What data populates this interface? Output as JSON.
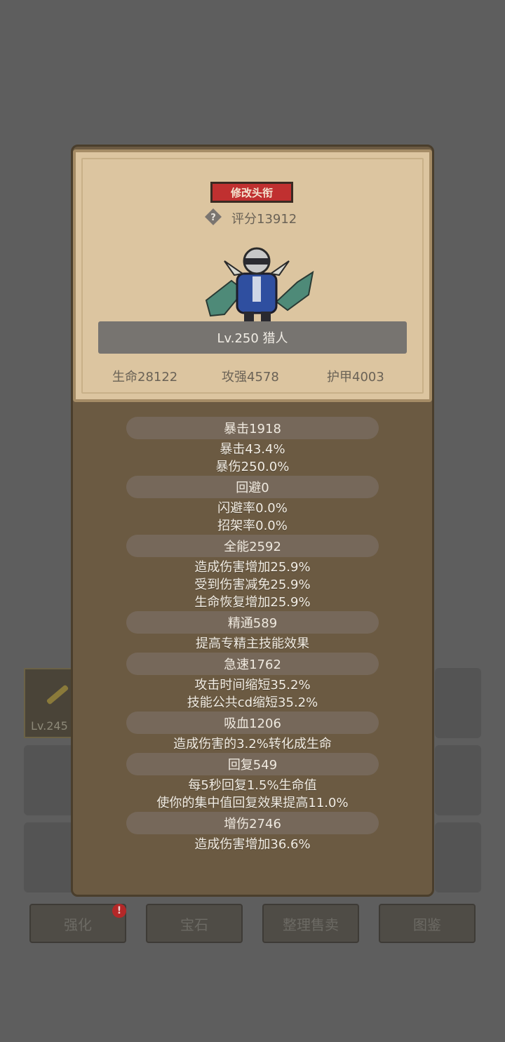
{
  "profile": {
    "edit_title_label": "修改头衔",
    "score_label": "评分13912",
    "level_class": "Lv.250 猎人",
    "hp": "生命28122",
    "attack": "攻强4578",
    "armor": "护甲4003"
  },
  "stats": [
    {
      "name": "暴击1918",
      "details": [
        "暴击43.4%",
        "暴伤250.0%"
      ]
    },
    {
      "name": "回避0",
      "details": [
        "闪避率0.0%",
        "招架率0.0%"
      ]
    },
    {
      "name": "全能2592",
      "details": [
        "造成伤害增加25.9%",
        "受到伤害减免25.9%",
        "生命恢复增加25.9%"
      ]
    },
    {
      "name": "精通589",
      "details": [
        "提高专精主技能效果"
      ]
    },
    {
      "name": "急速1762",
      "details": [
        "攻击时间缩短35.2%",
        "技能公共cd缩短35.2%"
      ]
    },
    {
      "name": "吸血1206",
      "details": [
        "造成伤害的3.2%转化成生命"
      ]
    },
    {
      "name": "回复549",
      "details": [
        "每5秒回复1.5%生命值",
        "使你的集中值回复效果提高11.0%"
      ]
    },
    {
      "name": "增伤2746",
      "details": [
        "造成伤害增加36.6%"
      ]
    }
  ],
  "background": {
    "item_level": "Lv.245",
    "buttons": [
      "强化",
      "宝石",
      "整理售卖",
      "图鉴"
    ],
    "badge": "!"
  },
  "colors": {
    "accent_red": "#c03030",
    "panel": "#6b5a42",
    "card": "#dcc5a0"
  },
  "icons": {
    "help": "question-diamond-icon",
    "hero": "hunter-character-sprite"
  }
}
